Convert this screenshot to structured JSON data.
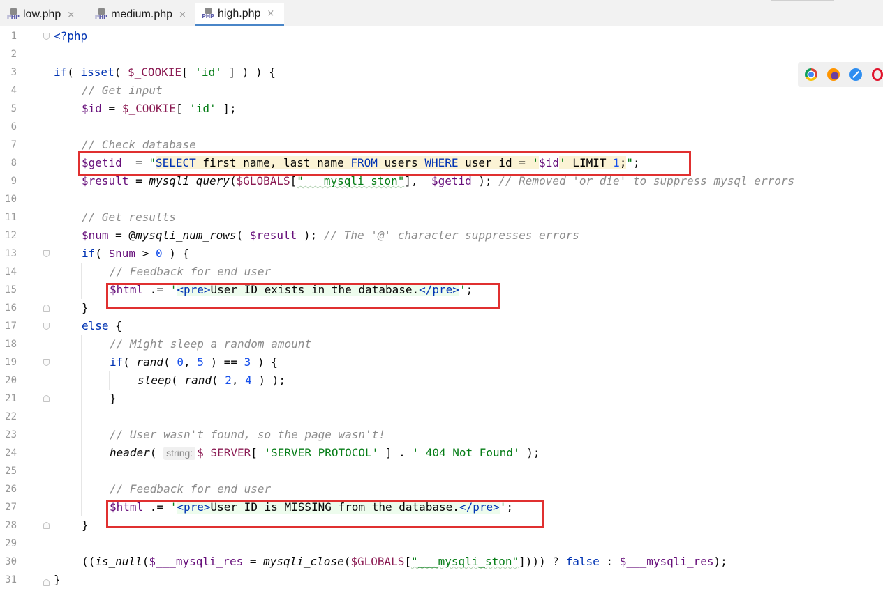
{
  "tabs": [
    {
      "label": "low.php",
      "icon": "php-file-icon",
      "active": false
    },
    {
      "label": "medium.php",
      "icon": "php-file-icon",
      "active": false
    },
    {
      "label": "high.php",
      "icon": "php-file-icon",
      "active": true
    }
  ],
  "php_icon_text": "PHP",
  "tab_close_glyph": "×",
  "hint_string": "string:",
  "line_numbers": [
    "1",
    "2",
    "3",
    "4",
    "5",
    "6",
    "7",
    "8",
    "9",
    "10",
    "11",
    "12",
    "13",
    "14",
    "15",
    "16",
    "17",
    "18",
    "19",
    "20",
    "21",
    "22",
    "23",
    "24",
    "25",
    "26",
    "27",
    "28",
    "29",
    "30",
    "31"
  ],
  "code": {
    "l1": [
      "<?php"
    ],
    "l3": [
      "if",
      "( ",
      "isset",
      "( ",
      "$_COOKIE",
      "[ ",
      "'id'",
      " ] ) ) {"
    ],
    "l4": [
      "// Get input"
    ],
    "l5": [
      "$id",
      " = ",
      "$_COOKIE",
      "[ ",
      "'id'",
      " ];"
    ],
    "l7": [
      "// Check database"
    ],
    "l8": [
      "$getid",
      "  = ",
      "\"",
      "SELECT",
      " ",
      "first_name",
      ", ",
      "last_name",
      " ",
      "FROM",
      " ",
      "users",
      " ",
      "WHERE",
      " ",
      "user_id",
      " = ",
      "'",
      "$id",
      "'",
      " LIMIT ",
      "1",
      ";",
      "\"",
      ";"
    ],
    "l9": [
      "$result",
      " = ",
      "mysqli_query",
      "(",
      "$GLOBALS",
      "[",
      "\"___mysqli_ston\"",
      "],  ",
      "$getid",
      " ); ",
      "// Removed 'or die' to suppress mysql errors"
    ],
    "l11": [
      "// Get results"
    ],
    "l12": [
      "$num",
      " = @",
      "mysqli_num_rows",
      "( ",
      "$result",
      " ); ",
      "// The '@' character suppresses errors"
    ],
    "l13": [
      "if",
      "( ",
      "$num",
      " > ",
      "0",
      " ) {"
    ],
    "l14": [
      "// Feedback for end user"
    ],
    "l15": [
      "$html",
      " .= ",
      "'",
      "<pre>",
      "User ID exists in the database.",
      "</pre>",
      "'",
      ";"
    ],
    "l16": [
      "}"
    ],
    "l17": [
      "else",
      " {"
    ],
    "l18": [
      "// Might sleep a random amount"
    ],
    "l19": [
      "if",
      "( ",
      "rand",
      "( ",
      "0",
      ", ",
      "5",
      " ) == ",
      "3",
      " ) {"
    ],
    "l20": [
      "sleep",
      "( ",
      "rand",
      "( ",
      "2",
      ", ",
      "4",
      " ) );"
    ],
    "l21": [
      "}"
    ],
    "l23": [
      "// User wasn't found, so the page wasn't!"
    ],
    "l24": [
      "header",
      "( ",
      "$_SERVER",
      "[ ",
      "'SERVER_PROTOCOL'",
      " ] . ",
      "' 404 Not Found'",
      " );"
    ],
    "l26": [
      "// Feedback for end user"
    ],
    "l27": [
      "$html",
      " .= ",
      "'",
      "<pre>",
      "User ID is MISSING from the database.",
      "</pre>",
      "'",
      ";"
    ],
    "l28": [
      "}"
    ],
    "l30": [
      "((",
      "is_null",
      "(",
      "$___mysqli_res",
      " = ",
      "mysqli_close",
      "(",
      "$GLOBALS",
      "[",
      "\"___mysqli_ston\"",
      "]))) ? ",
      "false",
      " : ",
      "$___mysqli_res",
      ");"
    ],
    "l31": [
      "}"
    ]
  },
  "browser_icons": [
    "chrome-icon",
    "firefox-icon",
    "safari-icon",
    "opera-icon"
  ],
  "colors": {
    "highlight_box": "#e03030",
    "active_tab_underline": "#4a86c8",
    "keyword": "#0033b3",
    "string": "#067d17",
    "comment": "#8c8c8c"
  }
}
